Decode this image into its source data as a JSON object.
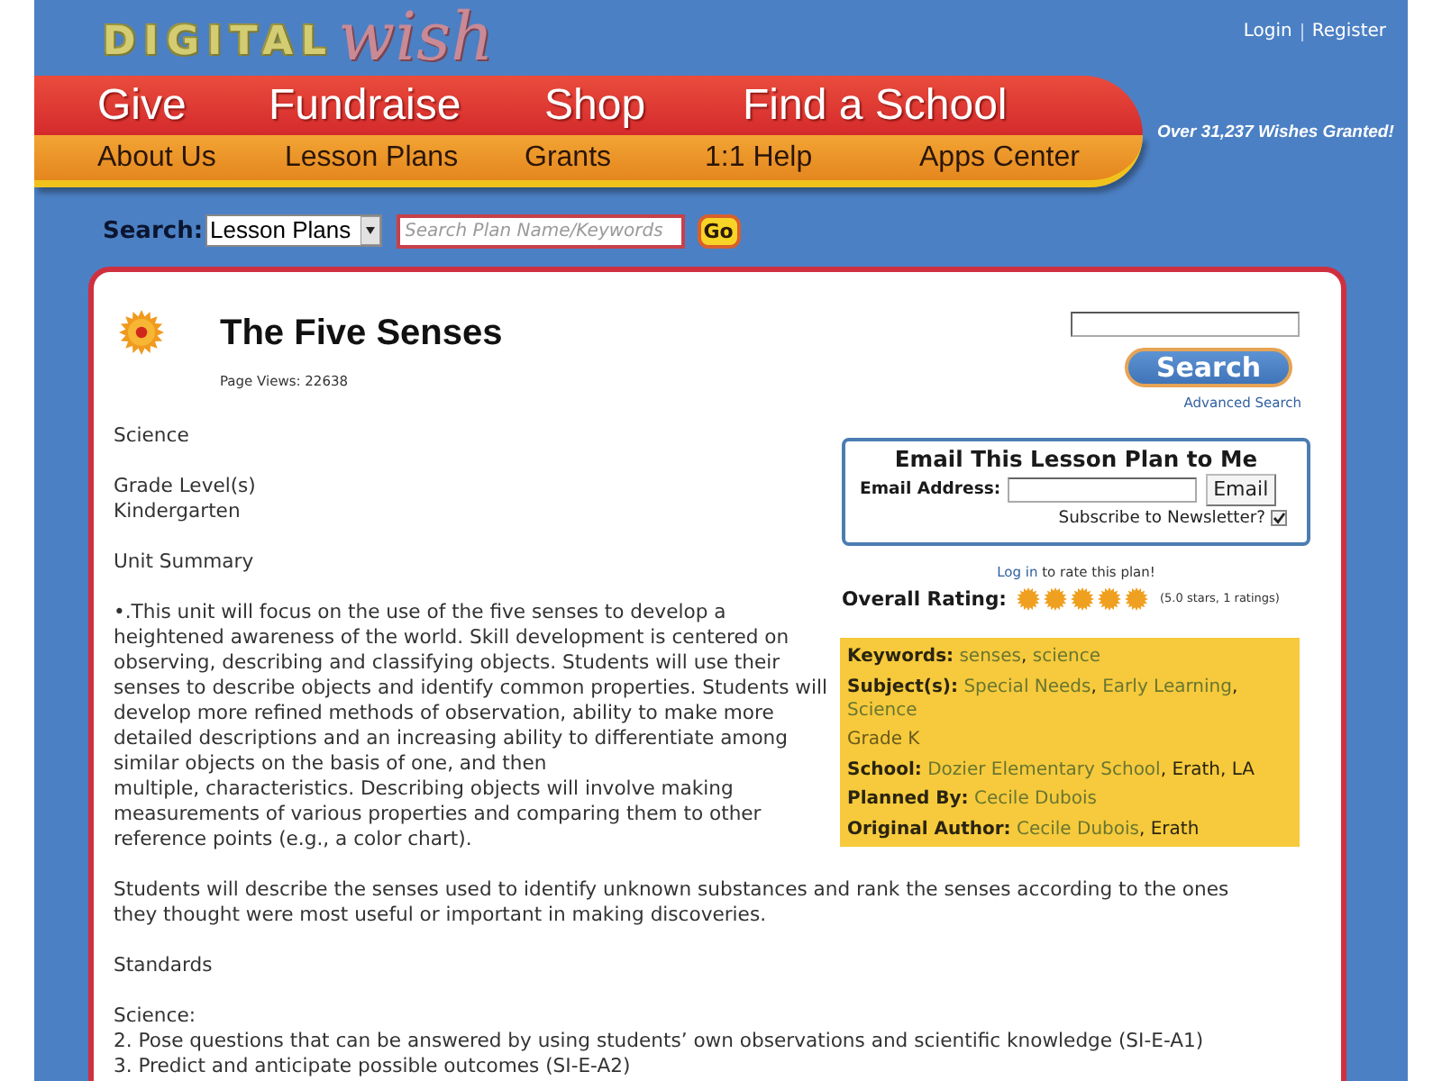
{
  "header": {
    "logo": {
      "prefix": "DIGITAL",
      "script": "wish"
    },
    "account_links": [
      "Login",
      "Register"
    ],
    "tagline": "Over 31,237 Wishes Granted!"
  },
  "main_nav": [
    "Give",
    "Fundraise",
    "Shop",
    "Find a School"
  ],
  "sub_nav": [
    "About Us",
    "Lesson Plans",
    "Grants",
    "1:1 Help",
    "Apps Center"
  ],
  "search": {
    "label": "Search:",
    "category": "Lesson Plans",
    "placeholder": "Search Plan Name/Keywords",
    "button": "Go"
  },
  "lesson": {
    "title": "The Five Senses",
    "page_views": "Page Views: 22638",
    "blocks": [
      {
        "lines": [
          "Science"
        ]
      },
      {
        "lines": [
          "Grade Level(s)",
          "Kindergarten"
        ]
      },
      {
        "lines": [
          "Unit Summary"
        ]
      },
      {
        "lines": [
          "•.This unit will focus on the use of the five senses to develop a heightened awareness of the world. Skill development is centered on observing, describing and classifying objects. Students will use their senses to describe objects and identify common properties. Students will develop more refined methods of observation, ability to make more detailed descriptions and an increasing ability to differentiate among similar objects on the basis of one, and then",
          "multiple, characteristics. Describing objects will involve making measurements of various properties and comparing them to other reference points (e.g., a color chart)."
        ]
      },
      {
        "lines": [
          "Students will describe the senses used to identify unknown substances and rank the senses according to the ones they thought were most useful or important in making discoveries."
        ]
      },
      {
        "lines": [
          "Standards"
        ]
      },
      {
        "lines": [
          "Science:",
          "2. Pose questions that can be answered by using students’ own observations and scientific knowledge (SI-E-A1)",
          "3. Predict and anticipate possible outcomes (SI-E-A2)"
        ]
      }
    ]
  },
  "sidebar": {
    "search_button": "Search",
    "advanced_link": "Advanced Search",
    "email_box": {
      "title": "Email This Lesson Plan to Me",
      "address_label": "Email Address:",
      "button": "Email",
      "newsletter_label": "Subscribe to Newsletter?",
      "newsletter_checked": true
    },
    "rate_prompt": {
      "link": "Log in",
      "text": " to rate this plan!"
    },
    "rating": {
      "label": "Overall Rating:",
      "stars": 5,
      "summary": "(5.0 stars, 1 ratings)"
    },
    "details": [
      {
        "kind": "field",
        "label": "Keywords:",
        "links": [
          "senses",
          "science"
        ],
        "separator": ","
      },
      {
        "kind": "field",
        "label": "Subject(s):",
        "links": [
          "Special Needs",
          "Early Learning",
          "Science"
        ],
        "separator": ","
      },
      {
        "kind": "note",
        "text": "Grade K"
      },
      {
        "kind": "field",
        "label": "School:",
        "links": [
          "Dozier Elementary School"
        ],
        "suffix": ", Erath, LA"
      },
      {
        "kind": "field",
        "label": "Planned By:",
        "links": [
          "Cecile Dubois"
        ]
      },
      {
        "kind": "field",
        "label": "Original Author:",
        "links": [
          "Cecile Dubois"
        ],
        "suffix": ", Erath"
      }
    ]
  }
}
